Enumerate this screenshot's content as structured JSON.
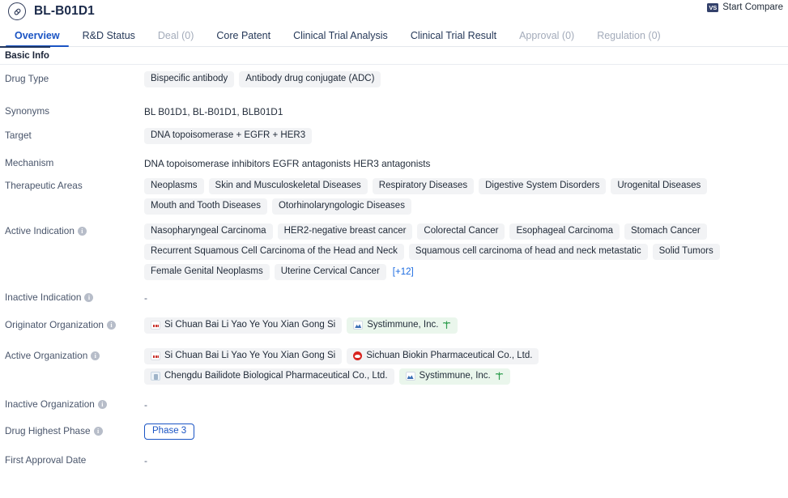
{
  "header": {
    "drug_icon": "capsule-icon",
    "title": "BL-B01D1",
    "compare": {
      "badge": "VS",
      "label": "Start Compare"
    }
  },
  "tabs": [
    {
      "label": "Overview",
      "state": "active"
    },
    {
      "label": "R&D Status",
      "state": "normal"
    },
    {
      "label": "Deal (0)",
      "state": "disabled"
    },
    {
      "label": "Core Patent",
      "state": "normal"
    },
    {
      "label": "Clinical Trial Analysis",
      "state": "normal"
    },
    {
      "label": "Clinical Trial Result",
      "state": "normal"
    },
    {
      "label": "Approval (0)",
      "state": "disabled"
    },
    {
      "label": "Regulation (0)",
      "state": "disabled"
    }
  ],
  "section": {
    "title": "Basic Info"
  },
  "rows": {
    "drug_type": {
      "label": "Drug Type",
      "tags": [
        "Bispecific antibody",
        "Antibody drug conjugate (ADC)"
      ]
    },
    "synonyms": {
      "label": "Synonyms",
      "text": "BL B01D1,  BL-B01D1,  BLB01D1"
    },
    "target": {
      "label": "Target",
      "tags": [
        "DNA topoisomerase + EGFR + HER3"
      ]
    },
    "mechanism": {
      "label": "Mechanism",
      "text": "DNA topoisomerase inhibitors  EGFR antagonists  HER3 antagonists"
    },
    "therapeutic_areas": {
      "label": "Therapeutic Areas",
      "tags": [
        "Neoplasms",
        "Skin and Musculoskeletal Diseases",
        "Respiratory Diseases",
        "Digestive System Disorders",
        "Urogenital Diseases",
        "Mouth and Tooth Diseases",
        "Otorhinolaryngologic Diseases"
      ]
    },
    "active_indication": {
      "label": "Active Indication",
      "has_info": true,
      "tags": [
        "Nasopharyngeal Carcinoma",
        "HER2-negative breast cancer",
        "Colorectal Cancer",
        "Esophageal Carcinoma",
        "Stomach Cancer",
        "Recurrent Squamous Cell Carcinoma of the Head and Neck",
        "Squamous cell carcinoma of head and neck metastatic",
        "Solid Tumors",
        "Female Genital Neoplasms",
        "Uterine Cervical Cancer"
      ],
      "more_link": "[+12]"
    },
    "inactive_indication": {
      "label": "Inactive Indication",
      "has_info": true,
      "text": "-"
    },
    "originator_organization": {
      "label": "Originator Organization",
      "has_info": true,
      "orgs": [
        {
          "name": "Si Chuan Bai Li Yao Ye You Xian Gong Si",
          "logo": "dots-logo",
          "style": "grey",
          "tree": false
        },
        {
          "name": "Systimmune, Inc.",
          "logo": "systimmune-logo",
          "style": "green",
          "tree": true
        }
      ]
    },
    "active_organization": {
      "label": "Active Organization",
      "has_info": true,
      "orgs": [
        {
          "name": "Si Chuan Bai Li Yao Ye You Xian Gong Si",
          "logo": "dots-logo",
          "style": "grey",
          "tree": false
        },
        {
          "name": "Sichuan Biokin Pharmaceutical Co., Ltd.",
          "logo": "biokin-logo",
          "style": "grey",
          "tree": false
        },
        {
          "name": "Chengdu Bailidote Biological Pharmaceutical Co., Ltd.",
          "logo": "document-logo",
          "style": "grey",
          "tree": false
        },
        {
          "name": "Systimmune, Inc.",
          "logo": "systimmune-logo",
          "style": "green",
          "tree": true
        }
      ]
    },
    "inactive_organization": {
      "label": "Inactive Organization",
      "has_info": true,
      "text": "-"
    },
    "drug_highest_phase": {
      "label": "Drug Highest Phase",
      "has_info": true,
      "phase": "Phase 3"
    },
    "first_approval_date": {
      "label": "First Approval Date",
      "text": "-"
    }
  },
  "colors": {
    "accent_blue": "#1a54c4",
    "tag_grey": "#f2f3f5",
    "tag_green": "#eaf6ec",
    "label_grey": "#49556b",
    "title_navy": "#1b2a4a"
  }
}
